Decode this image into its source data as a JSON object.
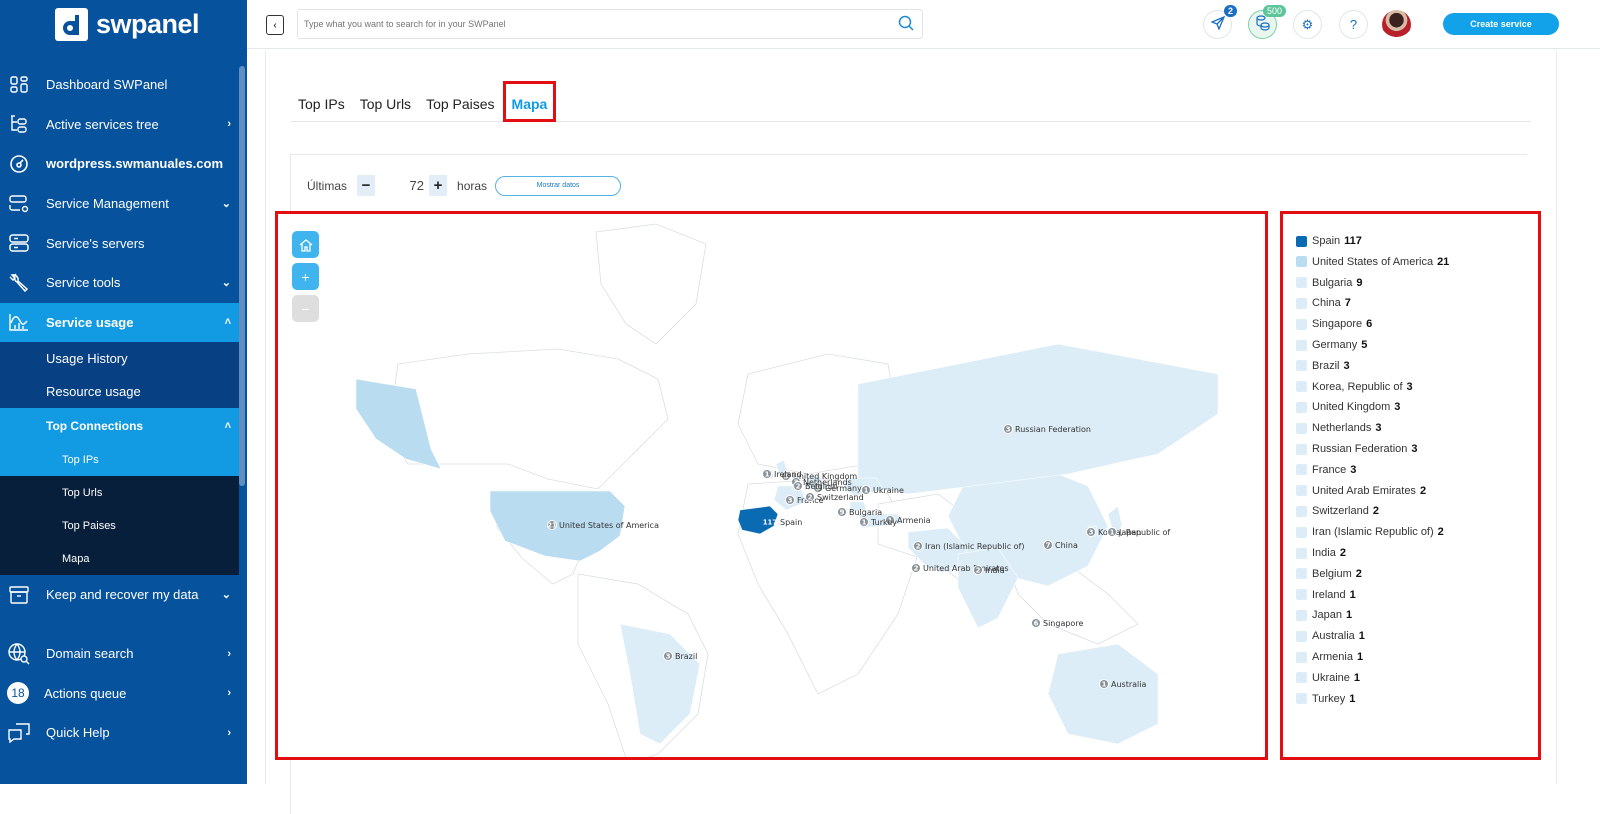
{
  "brand": {
    "name": "swpanel"
  },
  "sidebar": {
    "items": [
      {
        "label": "Dashboard SWPanel",
        "icon": "dashboard-icon"
      },
      {
        "label": "Active services tree",
        "icon": "tree-icon",
        "chevron": "›"
      },
      {
        "label": "wordpress.swmanuales.com",
        "icon": "speedometer-icon"
      },
      {
        "label": "Service Management",
        "icon": "server-gear-icon",
        "chevron": "⌄"
      },
      {
        "label": "Service's servers",
        "icon": "servers-icon"
      },
      {
        "label": "Service tools",
        "icon": "wrench-icon",
        "chevron": "⌄"
      },
      {
        "label": "Service usage",
        "icon": "chart-icon",
        "chevron": "˄"
      }
    ],
    "service_usage_children": [
      {
        "label": "Usage History"
      },
      {
        "label": "Resource usage"
      },
      {
        "label": "Top Connections",
        "chevron": "˄"
      }
    ],
    "top_connections_children": [
      {
        "label": "Top IPs"
      },
      {
        "label": "Top Urls"
      },
      {
        "label": "Top Paises"
      },
      {
        "label": "Mapa"
      }
    ],
    "bottom_items": [
      {
        "label": "Keep and recover my data",
        "icon": "archive-icon",
        "chevron": "⌄"
      },
      {
        "label": "Domain search",
        "icon": "globe-search-icon",
        "chevron": "›"
      },
      {
        "label": "Actions queue",
        "badge": "18",
        "chevron": "›"
      },
      {
        "label": "Quick Help",
        "icon": "chat-icon",
        "chevron": "›"
      }
    ]
  },
  "topbar": {
    "search_placeholder": "Type what you want to search for in your SWPanel",
    "notifications_count": "2",
    "credits_count": "500",
    "create_service_label": "Create service"
  },
  "tabs": [
    {
      "label": "Top IPs"
    },
    {
      "label": "Top Urls"
    },
    {
      "label": "Top Paises"
    },
    {
      "label": "Mapa",
      "active": true
    }
  ],
  "filter": {
    "prefix": "Últimas",
    "hours": "72",
    "minus": "−",
    "plus": "+",
    "suffix": "horas",
    "button": "Mostrar datos"
  },
  "colors": {
    "accent": "#129ae2",
    "sidebar": "#06529c",
    "highlight_border": "#e30d12",
    "map_max": "#0a6bb3",
    "map_high": "#b9dcf0",
    "map_low": "#dcedf8"
  },
  "chart_data": {
    "type": "choropleth-map",
    "title": "Mapa",
    "legend_placement": "right",
    "countries": [
      {
        "name": "Spain",
        "value": 117
      },
      {
        "name": "United States of America",
        "value": 21
      },
      {
        "name": "Bulgaria",
        "value": 9
      },
      {
        "name": "China",
        "value": 7
      },
      {
        "name": "Singapore",
        "value": 6
      },
      {
        "name": "Germany",
        "value": 5
      },
      {
        "name": "Brazil",
        "value": 3
      },
      {
        "name": "Korea, Republic of",
        "value": 3
      },
      {
        "name": "United Kingdom",
        "value": 3
      },
      {
        "name": "Netherlands",
        "value": 3
      },
      {
        "name": "Russian Federation",
        "value": 3
      },
      {
        "name": "France",
        "value": 3
      },
      {
        "name": "United Arab Emirates",
        "value": 2
      },
      {
        "name": "Switzerland",
        "value": 2
      },
      {
        "name": "Iran (Islamic Republic of)",
        "value": 2
      },
      {
        "name": "India",
        "value": 2
      },
      {
        "name": "Belgium",
        "value": 2
      },
      {
        "name": "Ireland",
        "value": 1
      },
      {
        "name": "Japan",
        "value": 1
      },
      {
        "name": "Australia",
        "value": 1
      },
      {
        "name": "Armenia",
        "value": 1
      },
      {
        "name": "Ukraine",
        "value": 1
      },
      {
        "name": "Turkey",
        "value": 1
      }
    ]
  }
}
